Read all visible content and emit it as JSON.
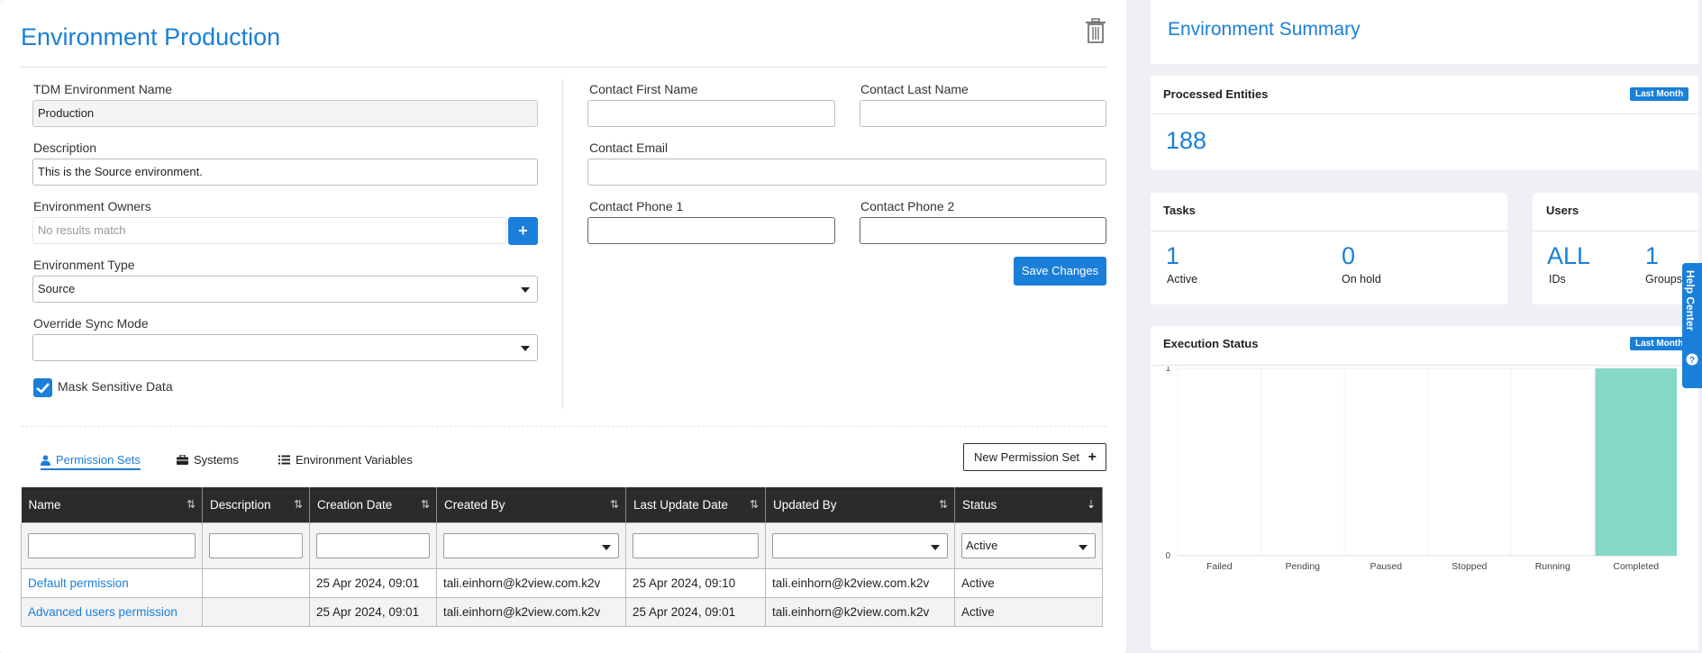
{
  "page": {
    "title": "Environment Production"
  },
  "form": {
    "env_name_label": "TDM Environment Name",
    "env_name_value": "Production",
    "description_label": "Description",
    "description_value": "This is the Source environment.",
    "owners_label": "Environment Owners",
    "owners_placeholder": "No results match",
    "type_label": "Environment Type",
    "type_value": "Source",
    "override_label": "Override Sync Mode",
    "override_value": "",
    "mask_label": "Mask Sensitive Data",
    "mask_checked": true,
    "contact_first_label": "Contact First Name",
    "contact_last_label": "Contact Last Name",
    "contact_email_label": "Contact Email",
    "contact_phone1_label": "Contact Phone 1",
    "contact_phone2_label": "Contact Phone 2",
    "save_label": "Save Changes"
  },
  "tabs": [
    {
      "label": "Permission Sets",
      "icon": "user-icon",
      "active": true
    },
    {
      "label": "Systems",
      "icon": "briefcase-icon",
      "active": false
    },
    {
      "label": "Environment Variables",
      "icon": "list-icon",
      "active": false
    }
  ],
  "new_permission_label": "New Permission Set",
  "table": {
    "columns": [
      "Name",
      "Description",
      "Creation Date",
      "Created By",
      "Last Update Date",
      "Updated By",
      "Status"
    ],
    "status_filter": "Active",
    "rows": [
      {
        "name": "Default permission",
        "description": "",
        "creation_date": "25 Apr 2024, 09:01",
        "created_by": "tali.einhorn@k2view.com.k2v",
        "last_update": "25 Apr 2024, 09:10",
        "updated_by": "tali.einhorn@k2view.com.k2v",
        "status": "Active"
      },
      {
        "name": "Advanced users permission",
        "description": "",
        "creation_date": "25 Apr 2024, 09:01",
        "created_by": "tali.einhorn@k2view.com.k2v",
        "last_update": "25 Apr 2024, 09:01",
        "updated_by": "tali.einhorn@k2view.com.k2v",
        "status": "Active"
      }
    ]
  },
  "summary": {
    "title": "Environment Summary",
    "processed_label": "Processed Entities",
    "processed_badge": "Last Month",
    "processed_value": "188",
    "tasks_label": "Tasks",
    "tasks_active_value": "1",
    "tasks_active_label": "Active",
    "tasks_hold_value": "0",
    "tasks_hold_label": "On hold",
    "users_label": "Users",
    "users_ids_value": "ALL",
    "users_ids_label": "IDs",
    "users_groups_value": "1",
    "users_groups_label": "Groups",
    "exec_label": "Execution Status",
    "exec_badge": "Last Month",
    "help_label": "Help Center"
  },
  "chart_data": {
    "type": "bar",
    "categories": [
      "Failed",
      "Pending",
      "Paused",
      "Stopped",
      "Running",
      "Completed"
    ],
    "values": [
      0,
      0,
      0,
      0,
      0,
      1
    ],
    "ylim": [
      0,
      1
    ],
    "yticks": [
      "0",
      "1"
    ],
    "bar_color": "#86d8c6"
  }
}
